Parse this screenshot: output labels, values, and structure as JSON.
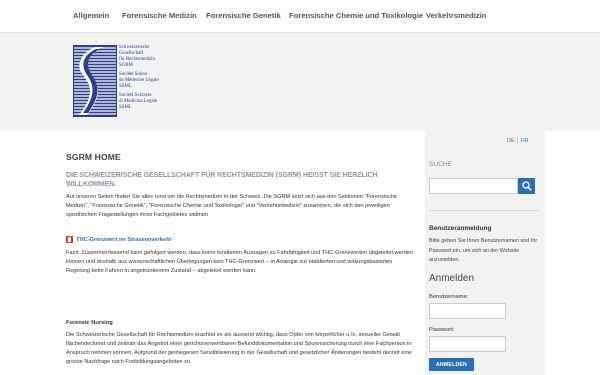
{
  "nav": {
    "items": [
      {
        "label": "Allgemein"
      },
      {
        "label": "Forensische Medizin"
      },
      {
        "label": "Forensische Genetik"
      },
      {
        "label": "Forensische Chemie und Toxikologie"
      },
      {
        "label": "Verkehrsmedizin"
      }
    ]
  },
  "logo": {
    "de": "Schweizerische\nGesellschaft\nfür Rechtsmedizin\nSGRM",
    "fr": "Société Suisse\nde Médecine Légale\nSSML",
    "it": "Società Svizzera\ndi Medicina Legale\nSSML"
  },
  "main": {
    "title": "SGRM HOME",
    "subhead": "DIE SCHWEIZERISCHE GESELLSCHAFT FÜR RECHTSMEDIZIN (SGRM) HEISST SIE HERZLICH WILLKOMMEN.",
    "intro": "Auf unseren Seiten finden Sie alles rund um die Rechtsmedizin in der Schweiz. Die SGRM setzt sich aus den Sektionen \"Forensische Medizin\", \"Forensische Genetik\", \"Forensische Chemie und Toxikologie\" und \"Verkehrsmedizin\" zusammen, die sich den jeweiligen spezifischen Fragestellungen ihres Fachgebietes widmen",
    "pdf_icon": "pdf-icon",
    "pdf_link": "THC-Grenzwert im Strassenverkehr",
    "fazit": "Fazit: Zusammenfassend kann gefolgert werden, dass keine fundierten Aussagen zu Fahrfähigkeit und THC-Grenzwerten abgeleitet werden können und deshalb aus wissenschaftlichen Überlegungen kein THC-Grenzwert – in Analogie zur etablierten und wirkungsbasierten Regelung beim Fahren in angetrunkenem Zustand – abgeleitet werden kann.",
    "section_title": "Forensic Nursing",
    "section_text": "Die Schweizerische Gesellschaft für Rechtsmedizin erachtet es als äusserst wichtig, dass Opfer von körperlicher u./o. sexueller Gewalt flächendeckend und zeitnah das Angebot einer gerichtsverwertbaren Befunddokumentation und Spurensicherung durch eine Fachperson in Anspruch nehmen können. Aufgrund der gestiegenen Sensibilisierung in der Gesellschaft und gesetzlicher Änderungen besteht derzeit eine grosse Nachfrage nach Fortbildungsangeboten zu"
  },
  "sidebar": {
    "lang_de": "DE",
    "lang_fr": "FR",
    "search_label": "SUCHE",
    "search_value": "",
    "search_icon": "search-icon",
    "login_heading": "Benutzeranmeldung",
    "login_text": "Bitte geben Sie Ihren Benutzernamen und Ihr Passwort ein, um sich an der Website anzumelden.",
    "login_title": "Anmelden",
    "username_label": "Benutzername:",
    "username_value": "",
    "password_label": "Passwort:",
    "password_value": "",
    "login_button": "ANMELDEN"
  },
  "colors": {
    "accent": "#2a6fb5",
    "logo_blue": "#2d3e8a",
    "band": "#f2f2f2",
    "subhead": "#8a93a0"
  }
}
